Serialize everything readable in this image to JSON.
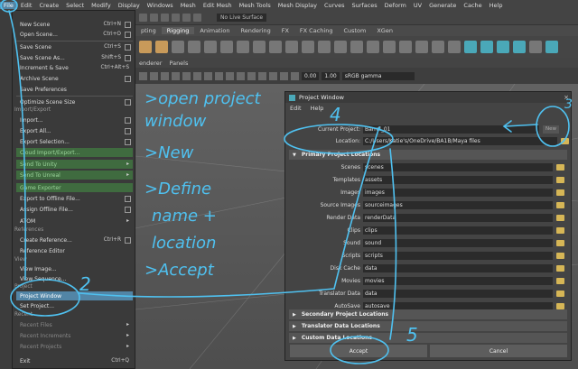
{
  "menubar": [
    "File",
    "Edit",
    "Create",
    "Select",
    "Modify",
    "Display",
    "Windows",
    "Mesh",
    "Edit Mesh",
    "Mesh Tools",
    "Mesh Display",
    "Curves",
    "Surfaces",
    "Deform",
    "UV",
    "Generate",
    "Cache",
    "Help"
  ],
  "status": {
    "live_surface": "No Live Surface"
  },
  "shelf_tabs": [
    "pting",
    "Rigging",
    "Animation",
    "Rendering",
    "FX",
    "FX Caching",
    "Custom",
    "XGen"
  ],
  "panel_menu": [
    "enderer",
    "Panels"
  ],
  "viewbar": {
    "value1": "0.00",
    "value2": "1.00",
    "color_space": "sRGB gamma"
  },
  "file_menu": {
    "items": [
      {
        "label": "New Scene",
        "shortcut": "Ctrl+N"
      },
      {
        "label": "Open Scene...",
        "shortcut": "Ctrl+O"
      },
      {
        "label": "Save Scene",
        "shortcut": "Ctrl+S"
      },
      {
        "label": "Save Scene As...",
        "shortcut": "Shift+S"
      },
      {
        "label": "Increment & Save",
        "shortcut": "Ctrl+Alt+S"
      },
      {
        "label": "Archive Scene",
        "shortcut": ""
      },
      {
        "label": "Save Preferences",
        "shortcut": ""
      },
      {
        "label": "Optimize Scene Size",
        "shortcut": ""
      },
      {
        "label": "Import...",
        "shortcut": ""
      },
      {
        "label": "Export All...",
        "shortcut": ""
      },
      {
        "label": "Export Selection...",
        "shortcut": ""
      },
      {
        "label": "Cloud Import/Export...",
        "shortcut": ""
      },
      {
        "label": "Send To Unity",
        "shortcut": ""
      },
      {
        "label": "Send To Unreal",
        "shortcut": ""
      },
      {
        "label": "Game Exporter",
        "shortcut": ""
      },
      {
        "label": "Export to Offline File...",
        "shortcut": ""
      },
      {
        "label": "Assign Offline File...",
        "shortcut": ""
      },
      {
        "label": "ATOM",
        "shortcut": ""
      },
      {
        "label": "Create Reference...",
        "shortcut": "Ctrl+R"
      },
      {
        "label": "Reference Editor",
        "shortcut": ""
      },
      {
        "label": "View Image...",
        "shortcut": ""
      },
      {
        "label": "View Sequence...",
        "shortcut": ""
      },
      {
        "label": "Project Window",
        "shortcut": ""
      },
      {
        "label": "Set Project...",
        "shortcut": ""
      },
      {
        "label": "Recent Files",
        "shortcut": ""
      },
      {
        "label": "Recent Increments",
        "shortcut": ""
      },
      {
        "label": "Recent Projects",
        "shortcut": ""
      },
      {
        "label": "Exit",
        "shortcut": "Ctrl+Q"
      }
    ],
    "sections": [
      "Import/Export",
      "References",
      "View",
      "Project",
      "Recent"
    ]
  },
  "project_window": {
    "title": "Project Window",
    "menu": [
      "Edit",
      "Help"
    ],
    "current_project_label": "Current Project:",
    "current_project": "Barrel_01",
    "new_button": "New",
    "location_label": "Location:",
    "location": "C:/Users/Katie's/OneDrive/BA1B/Maya files",
    "primary_header": "Primary Project Locations",
    "rows": [
      {
        "label": "Scenes",
        "value": "scenes"
      },
      {
        "label": "Templates",
        "value": "assets"
      },
      {
        "label": "Images",
        "value": "images"
      },
      {
        "label": "Source Images",
        "value": "sourceimages"
      },
      {
        "label": "Render Data",
        "value": "renderData"
      },
      {
        "label": "Clips",
        "value": "clips"
      },
      {
        "label": "Sound",
        "value": "sound"
      },
      {
        "label": "Scripts",
        "value": "scripts"
      },
      {
        "label": "Disk Cache",
        "value": "data"
      },
      {
        "label": "Movies",
        "value": "movies"
      },
      {
        "label": "Translator Data",
        "value": "data"
      },
      {
        "label": "AutoSave",
        "value": "autosave"
      }
    ],
    "secondary_header": "Secondary Project Locations",
    "translator_header": "Translator Data Locations",
    "custom_header": "Custom Data Locations",
    "accept": "Accept",
    "cancel": "Cancel"
  },
  "annotations": {
    "step1_lines": [
      ">open project",
      "window",
      ">New",
      ">Define",
      "name +",
      "location",
      ">Accept"
    ],
    "numbers": [
      "2",
      "4",
      "5",
      "3"
    ]
  }
}
